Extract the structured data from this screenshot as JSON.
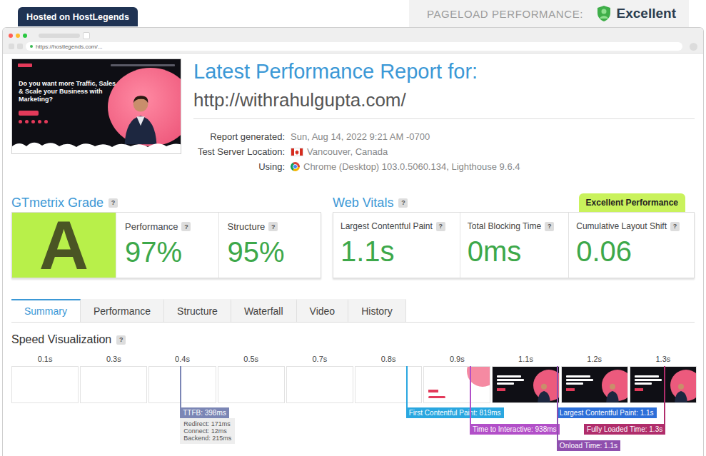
{
  "top_bar": {
    "hosting_tab": "Hosted on HostLegends",
    "pageload_label": "PAGELOAD PERFORMANCE:",
    "pageload_rating": "Excellent"
  },
  "browser": {
    "address": "https://hostlegends.com/..."
  },
  "help_glyph": "?",
  "thumbnail": {
    "headline": "Do you want more Traffic, Sales & Scale your Business with Marketing?"
  },
  "report": {
    "title": "Latest Performance Report for:",
    "url": "http://withrahulgupta.com/",
    "info": [
      {
        "label": "Report generated:",
        "value": "Sun, Aug 14, 2022 9:21 AM -0700",
        "kind": "plain"
      },
      {
        "label": "Test Server Location:",
        "value": "Vancouver, Canada",
        "kind": "location"
      },
      {
        "label": "Using:",
        "value": "Chrome (Desktop) 103.0.5060.134, Lighthouse 9.6.4",
        "kind": "browser"
      }
    ]
  },
  "grade": {
    "title": "GTmetrix Grade",
    "letter": "A",
    "metrics": [
      {
        "label": "Performance",
        "value": "97%"
      },
      {
        "label": "Structure",
        "value": "95%"
      }
    ]
  },
  "web_vitals": {
    "title": "Web Vitals",
    "badge": "Excellent Performance",
    "metrics": [
      {
        "label": "Largest Contentful Paint",
        "value": "1.1s"
      },
      {
        "label": "Total Blocking Time",
        "value": "0ms"
      },
      {
        "label": "Cumulative Layout Shift",
        "value": "0.06"
      }
    ]
  },
  "tabs": [
    {
      "label": "Summary",
      "selected": true
    },
    {
      "label": "Performance",
      "selected": false
    },
    {
      "label": "Structure",
      "selected": false
    },
    {
      "label": "Waterfall",
      "selected": false
    },
    {
      "label": "Video",
      "selected": false
    },
    {
      "label": "History",
      "selected": false
    }
  ],
  "speed": {
    "title": "Speed Visualization",
    "frames": [
      {
        "label": "0.1s",
        "kind": "blank"
      },
      {
        "label": "0.3s",
        "kind": "blank"
      },
      {
        "label": "0.4s",
        "kind": "blank"
      },
      {
        "label": "0.5s",
        "kind": "blank"
      },
      {
        "label": "0.7s",
        "kind": "blank"
      },
      {
        "label": "0.8s",
        "kind": "blank"
      },
      {
        "label": "0.9s",
        "kind": "partial"
      },
      {
        "label": "1.1s",
        "kind": "loaded"
      },
      {
        "label": "1.2s",
        "kind": "loaded"
      },
      {
        "label": "1.3s",
        "kind": "loaded"
      }
    ],
    "markers": [
      {
        "label": "TTFB: 398ms",
        "time": 0.398,
        "color": "#7b86b5",
        "details": [
          "Redirect: 171ms",
          "Connect: 12ms",
          "Backend: 215ms"
        ]
      },
      {
        "label": "First Contentful Paint: 819ms",
        "time": 0.819,
        "color": "#2aa7e0",
        "details": []
      },
      {
        "label": "Time to Interactive: 938ms",
        "time": 0.938,
        "color": "#b24fc8",
        "details": []
      },
      {
        "label": "Largest Contentful Paint: 1.1s",
        "time": 1.1,
        "color": "#2d6fd8",
        "details": []
      },
      {
        "label": "Onload Time: 1.1s",
        "time": 1.1,
        "color": "#8f4fae",
        "details": []
      },
      {
        "label": "Fully Loaded Time: 1.3s",
        "time": 1.3,
        "color": "#b02d6b",
        "details": []
      }
    ]
  }
}
